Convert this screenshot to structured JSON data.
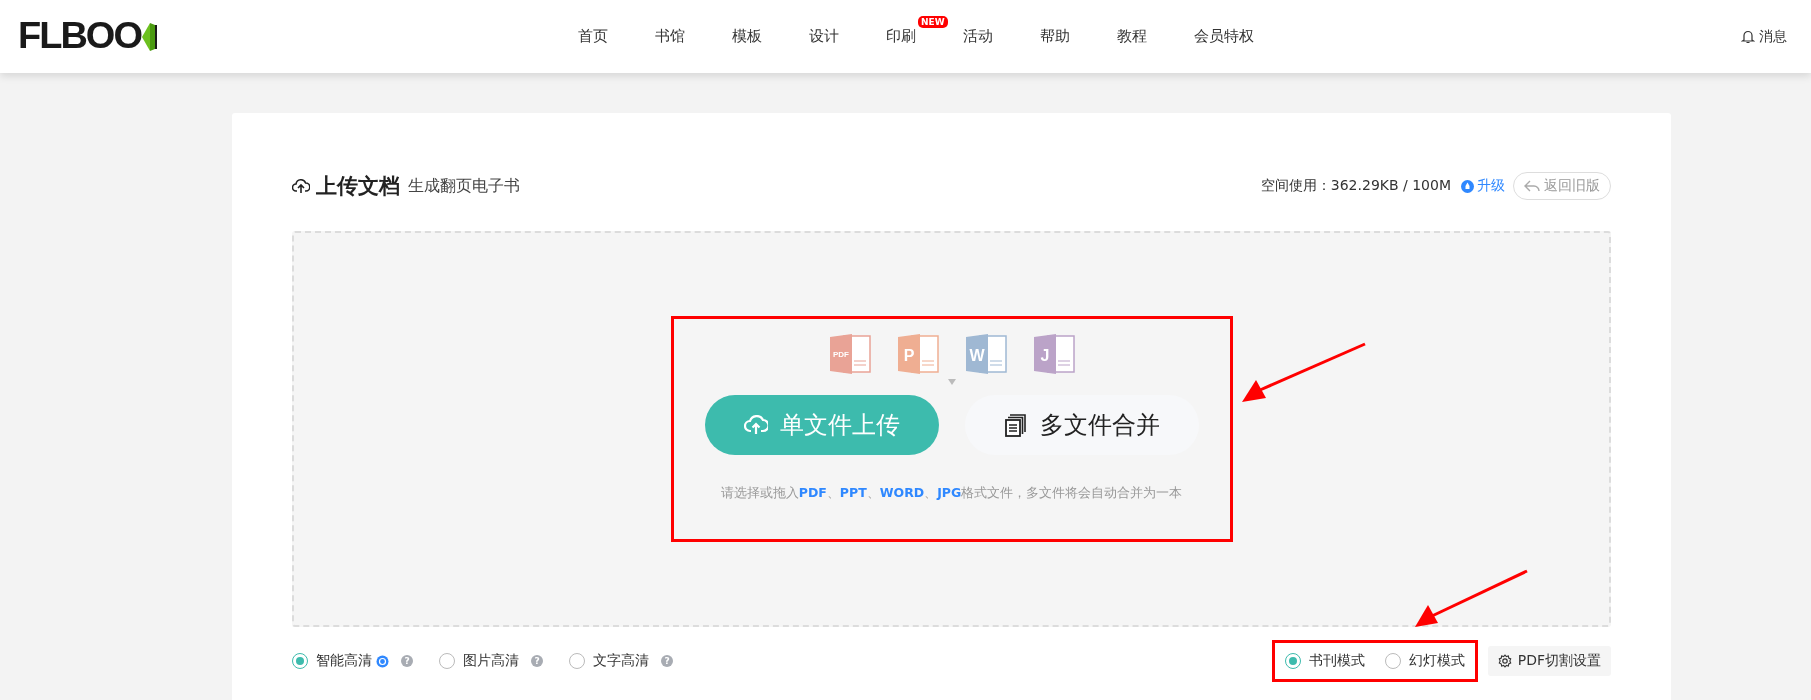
{
  "header": {
    "logo": "FLBOO",
    "nav": [
      {
        "label": "首页"
      },
      {
        "label": "书馆"
      },
      {
        "label": "模板"
      },
      {
        "label": "设计"
      },
      {
        "label": "印刷",
        "badge": "NEW"
      },
      {
        "label": "活动"
      },
      {
        "label": "帮助"
      },
      {
        "label": "教程"
      },
      {
        "label": "会员特权"
      }
    ],
    "messages": "消息"
  },
  "upload": {
    "title": "上传文档",
    "subtitle": "生成翻页电子书",
    "usage": "空间使用：362.29KB / 100M",
    "upgrade": "升级",
    "back": "返回旧版",
    "file_types": [
      {
        "kind": "pdf",
        "label": "PDF"
      },
      {
        "kind": "ppt",
        "label": "P"
      },
      {
        "kind": "word",
        "label": "W"
      },
      {
        "kind": "jpg",
        "label": "J"
      }
    ],
    "single_button": "单文件上传",
    "multi_button": "多文件合并",
    "hint": "请选择或拖入**PDF**、**PPT**、**WORD**、**JPG**格式文件，多文件将会自动合并为一本",
    "quality": [
      {
        "label": "智能高清",
        "selected": true,
        "recommended": true,
        "help": "?"
      },
      {
        "label": "图片高清",
        "selected": false,
        "recommended": false,
        "help": "?"
      },
      {
        "label": "文字高清",
        "selected": false,
        "recommended": false,
        "help": "?"
      }
    ],
    "modes": [
      {
        "label": "书刊模式",
        "selected": true
      },
      {
        "label": "幻灯模式",
        "selected": false
      }
    ],
    "pdf_settings": "PDF切割设置"
  }
}
